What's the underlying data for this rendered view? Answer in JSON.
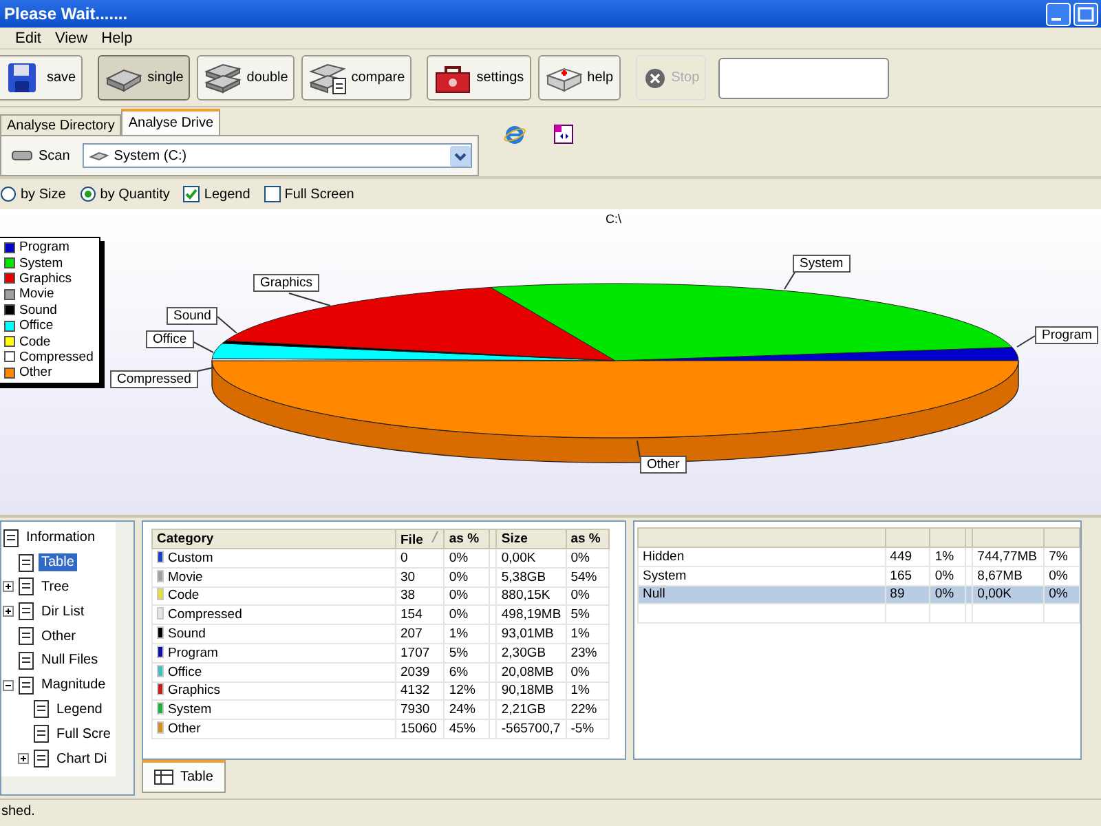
{
  "window": {
    "title": "Please Wait......."
  },
  "menu": [
    "Edit",
    "View",
    "Help"
  ],
  "toolbar": [
    {
      "kind": "save",
      "label": "save",
      "pressed": false,
      "disabled": false
    },
    {
      "kind": "single",
      "label": "single",
      "pressed": true,
      "disabled": false
    },
    {
      "kind": "double",
      "label": "double",
      "pressed": false,
      "disabled": false
    },
    {
      "kind": "compare",
      "label": "compare",
      "pressed": false,
      "disabled": false
    },
    {
      "kind": "settings",
      "label": "settings",
      "pressed": false,
      "disabled": false
    },
    {
      "kind": "help",
      "label": "help",
      "pressed": false,
      "disabled": false
    },
    {
      "kind": "stop",
      "label": "Stop",
      "pressed": false,
      "disabled": true
    }
  ],
  "tabs": [
    {
      "label": "Analyse Directory",
      "selected": false
    },
    {
      "label": "Analyse Drive",
      "selected": true
    }
  ],
  "scan_button": "Scan",
  "drive_select": {
    "value": "System (C:)"
  },
  "options": [
    {
      "kind": "radio",
      "label": "by Size",
      "selected": false
    },
    {
      "kind": "radio",
      "label": "by Quantity",
      "selected": true
    },
    {
      "kind": "checkbox",
      "label": "Legend",
      "checked": true
    },
    {
      "kind": "checkbox",
      "label": "Full Screen",
      "checked": false
    }
  ],
  "chart": {
    "title": "C:\\",
    "legend": [
      {
        "name": "Program",
        "color": "#0000c8"
      },
      {
        "name": "System",
        "color": "#00e600"
      },
      {
        "name": "Graphics",
        "color": "#e60000"
      },
      {
        "name": "Movie",
        "color": "#a0a0a0"
      },
      {
        "name": "Sound",
        "color": "#000000"
      },
      {
        "name": "Office",
        "color": "#00ffff"
      },
      {
        "name": "Code",
        "color": "#ffff00"
      },
      {
        "name": "Compressed",
        "color": "#ffffff"
      },
      {
        "name": "Other",
        "color": "#ff8800"
      }
    ],
    "slice_labels": [
      "Graphics",
      "Sound",
      "Office",
      "Compressed",
      "System",
      "Program",
      "Other"
    ]
  },
  "tree": [
    {
      "label": "Information",
      "selected": false,
      "children": [
        {
          "label": "Table",
          "selected": true
        },
        {
          "label": "Tree",
          "selected": false,
          "expanded": false
        },
        {
          "label": "Dir List",
          "selected": false,
          "expanded": false
        },
        {
          "label": "Other",
          "selected": false
        },
        {
          "label": "Null Files",
          "selected": false
        },
        {
          "label": "Magnitude",
          "selected": false,
          "expanded": true,
          "children": [
            {
              "label": "Legend",
              "selected": false
            },
            {
              "label": "Full Scre",
              "selected": false
            },
            {
              "label": "Chart Di",
              "selected": false,
              "expanded": false
            }
          ]
        }
      ]
    }
  ],
  "category_table": {
    "columns": [
      {
        "label": "Category",
        "sorted": false
      },
      {
        "label": "File",
        "sorted": true
      },
      {
        "label": "as %",
        "sorted": false
      },
      {
        "label": "Size",
        "sorted": false
      },
      {
        "label": "as %",
        "sorted": false
      }
    ],
    "rows": [
      {
        "color": "#2040c0",
        "cells": [
          "Custom",
          "0",
          "0%",
          "0,00K",
          "0%"
        ]
      },
      {
        "color": "#a0a0a0",
        "cells": [
          "Movie",
          "30",
          "0%",
          "5,38GB",
          "54%"
        ]
      },
      {
        "color": "#e0e040",
        "cells": [
          "Code",
          "38",
          "0%",
          "880,15K",
          "0%"
        ]
      },
      {
        "color": "#e4e4e4",
        "cells": [
          "Compressed",
          "154",
          "0%",
          "498,19MB",
          "5%"
        ]
      },
      {
        "color": "#000000",
        "cells": [
          "Sound",
          "207",
          "1%",
          "93,01MB",
          "1%"
        ]
      },
      {
        "color": "#1010a0",
        "cells": [
          "Program",
          "1707",
          "5%",
          "2,30GB",
          "23%"
        ]
      },
      {
        "color": "#40c0c0",
        "cells": [
          "Office",
          "2039",
          "6%",
          "20,08MB",
          "0%"
        ]
      },
      {
        "color": "#c02020",
        "cells": [
          "Graphics",
          "4132",
          "12%",
          "90,18MB",
          "1%"
        ]
      },
      {
        "color": "#20b040",
        "cells": [
          "System",
          "7930",
          "24%",
          "2,21GB",
          "22%"
        ]
      },
      {
        "color": "#d09020",
        "cells": [
          "Other",
          "15060",
          "45%",
          "-565700,7",
          "-5%"
        ]
      }
    ]
  },
  "bottom_tabs": [
    {
      "label": "Table",
      "selected": true
    }
  ],
  "attributes_table": {
    "rows": [
      {
        "selected": false,
        "cells": [
          "Hidden",
          "449",
          "1%",
          "744,77MB",
          "7%"
        ]
      },
      {
        "selected": false,
        "cells": [
          "System",
          "165",
          "0%",
          "8,67MB",
          "0%"
        ]
      },
      {
        "selected": true,
        "cells": [
          "Null",
          "89",
          "0%",
          "0,00K",
          "0%"
        ]
      }
    ]
  },
  "status_bar": "shed."
}
